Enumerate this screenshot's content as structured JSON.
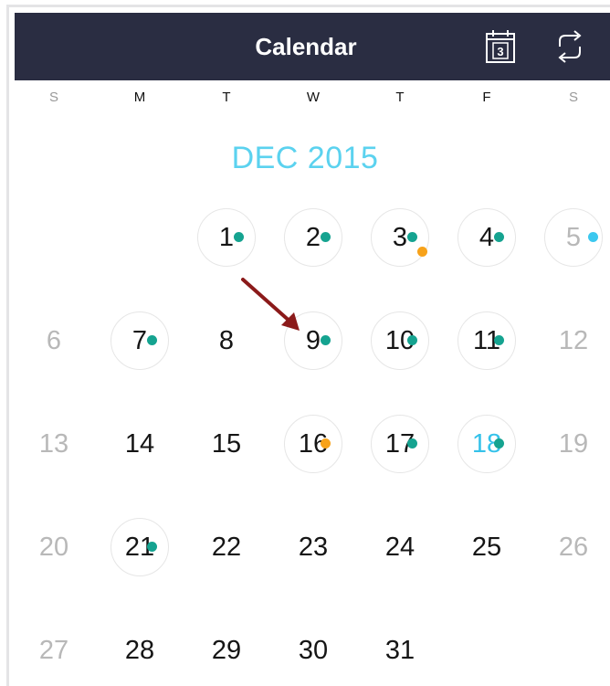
{
  "header": {
    "title": "Calendar",
    "calendar_icon_day": "3",
    "calendar_icon": "calendar-icon",
    "refresh_icon": "refresh-icon",
    "background": "#2a2d42"
  },
  "weekdays": [
    "S",
    "M",
    "T",
    "W",
    "T",
    "F",
    "S"
  ],
  "month_label": "DEC 2015",
  "colors": {
    "accent": "#5bd2ef",
    "today": "#35c2ea",
    "event_teal": "#15a390",
    "event_orange": "#f7a21a",
    "event_cyan": "#3cc8ef",
    "annotation_arrow": "#8b1a1a"
  },
  "days": [
    {
      "label": "1",
      "ring": true,
      "dots": [
        "teal"
      ]
    },
    {
      "label": "2",
      "ring": true,
      "dots": [
        "teal"
      ]
    },
    {
      "label": "3",
      "ring": true,
      "dots": [
        "teal",
        "orange"
      ]
    },
    {
      "label": "4",
      "ring": true,
      "dots": [
        "teal"
      ]
    },
    {
      "label": "5",
      "ring": true,
      "dots": [
        "cyan"
      ],
      "weekend": true
    },
    {
      "label": "6",
      "weekend": true
    },
    {
      "label": "7",
      "ring": true,
      "dots": [
        "teal"
      ]
    },
    {
      "label": "8"
    },
    {
      "label": "9",
      "ring": true,
      "dots": [
        "teal"
      ]
    },
    {
      "label": "10",
      "ring": true,
      "dots": [
        "teal"
      ]
    },
    {
      "label": "11",
      "ring": true,
      "dots": [
        "teal"
      ]
    },
    {
      "label": "12",
      "weekend": true
    },
    {
      "label": "13",
      "weekend": true
    },
    {
      "label": "14"
    },
    {
      "label": "15"
    },
    {
      "label": "16",
      "ring": true,
      "dots": [
        "orange"
      ]
    },
    {
      "label": "17",
      "ring": true,
      "dots": [
        "teal"
      ]
    },
    {
      "label": "18",
      "ring": true,
      "dots": [
        "teal"
      ],
      "today": true
    },
    {
      "label": "19",
      "weekend": true
    },
    {
      "label": "20",
      "weekend": true
    },
    {
      "label": "21",
      "ring": true,
      "dots": [
        "teal"
      ]
    },
    {
      "label": "22"
    },
    {
      "label": "23"
    },
    {
      "label": "24"
    },
    {
      "label": "25"
    },
    {
      "label": "26",
      "weekend": true
    },
    {
      "label": "27",
      "weekend": true
    },
    {
      "label": "28"
    },
    {
      "label": "29"
    },
    {
      "label": "30"
    },
    {
      "label": "31"
    }
  ],
  "first_weekday_index": 2
}
